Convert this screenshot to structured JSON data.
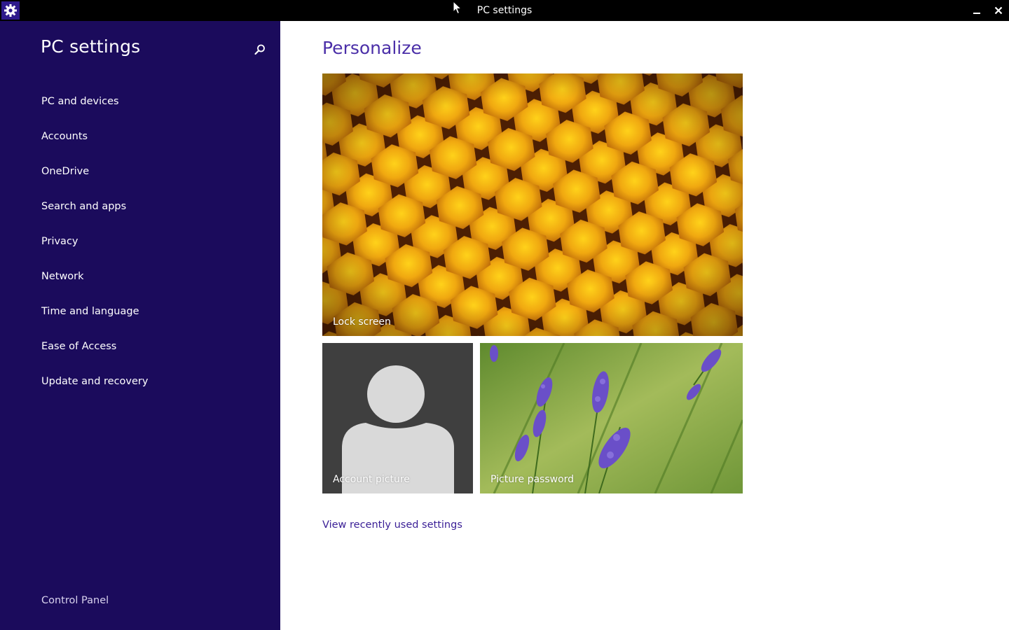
{
  "window": {
    "title": "PC settings",
    "icon": "gear-icon",
    "controls": [
      "minimize-icon",
      "close-icon"
    ]
  },
  "sidebar": {
    "title": "PC settings",
    "search_icon": "search-icon",
    "items": [
      {
        "label": "PC and devices"
      },
      {
        "label": "Accounts"
      },
      {
        "label": "OneDrive"
      },
      {
        "label": "Search and apps"
      },
      {
        "label": "Privacy"
      },
      {
        "label": "Network"
      },
      {
        "label": "Time and language"
      },
      {
        "label": "Ease of Access"
      },
      {
        "label": "Update and recovery"
      }
    ],
    "footer_link": "Control Panel"
  },
  "main": {
    "title": "Personalize",
    "tiles": {
      "lock_screen": "Lock screen",
      "account_picture": "Account picture",
      "picture_password": "Picture password"
    },
    "recent_link": "View recently used settings"
  },
  "colors": {
    "sidebar_bg": "#1b0b5c",
    "accent": "#4b2fa8",
    "titlebar_bg": "#000000"
  }
}
